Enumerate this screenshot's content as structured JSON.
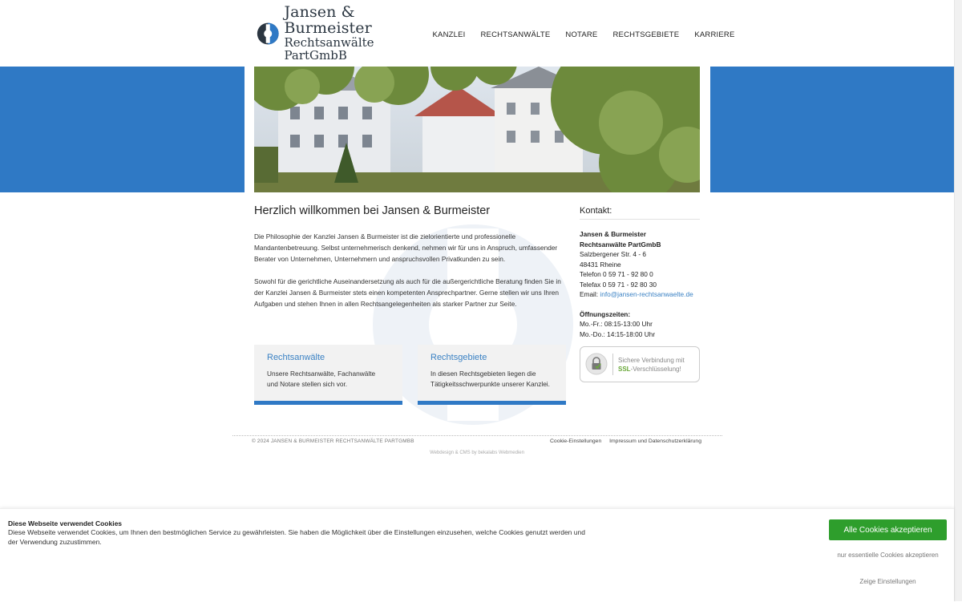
{
  "brand": {
    "name_line1": "Jansen & Burmeister",
    "name_line2": "Rechtsanwälte PartGmbB",
    "accent": "#2f79c5",
    "link_color": "#3b82c4"
  },
  "nav": {
    "items": [
      {
        "label": "KANZLEI"
      },
      {
        "label": "RECHTSANWÄLTE"
      },
      {
        "label": "NOTARE"
      },
      {
        "label": "RECHTSGEBIETE"
      },
      {
        "label": "KARRIERE"
      }
    ]
  },
  "main": {
    "title": "Herzlich willkommen bei Jansen & Burmeister",
    "paragraph1": "Die Philosophie der Kanzlei Jansen & Burmeister ist die zielorientierte und professionelle Mandantenbetreuung. Selbst unternehmerisch denkend, nehmen wir für uns in Anspruch, umfassender Berater von Unternehmen, Unternehmern und anspruchsvollen Privatkunden zu sein.",
    "paragraph2": "Sowohl für die gerichtliche Auseinandersetzung als auch für die außergerichtliche Beratung finden Sie in der Kanzlei Jansen & Burmeister stets einen kompetenten Ansprechpartner. Gerne stellen wir uns Ihren Aufgaben und stehen Ihnen in allen Rechtsangelegenheiten als starker Partner zur Seite."
  },
  "cards": [
    {
      "title": "Rechtsanwälte",
      "text": "Unsere Rechtsanwälte, Fachanwälte und Notare stellen sich vor."
    },
    {
      "title": "Rechtsgebiete",
      "text": "In diesen Rechtsgebieten liegen die Tätigkeitsschwerpunkte unserer Kanzlei."
    }
  ],
  "contact": {
    "heading": "Kontakt:",
    "firm_line1": "Jansen & Burmeister",
    "firm_line2": "Rechtsanwälte PartGmbB",
    "street": "Salzbergener Str. 4 - 6",
    "city": "48431 Rheine",
    "phone": "Telefon 0 59 71 - 92 80 0",
    "fax": "Telefax 0 59 71 - 92 80 30",
    "email_label": "Email: ",
    "email": "info@jansen-rechtsanwaelte.de",
    "hours_heading": "Öffnungszeiten:",
    "hours_line1": "Mo.-Fr.: 08:15-13:00 Uhr",
    "hours_line2": "Mo.-Do.: 14:15-18:00 Uhr"
  },
  "ssl_badge": {
    "line1": "Sichere Verbindung mit",
    "ssl": "SSL",
    "line2_rest": "-Verschlüsselung!"
  },
  "footer": {
    "copyright": "© 2024 JANSEN & BURMEISTER RECHTSANWÄLTE PARTGMBB",
    "link_cookies": "Cookie-Einstellungen",
    "link_imprint": "Impressum und Datenschutzerklärung",
    "credit": "Webdesign & CMS by bekalabs Webmedien"
  },
  "cookie_banner": {
    "title": "Diese Webseite verwendet Cookies",
    "text": "Diese Webseite verwendet Cookies, um Ihnen den bestmöglichen Service zu gewährleisten. Sie haben die Möglichkeit über die Einstellungen einzusehen, welche Cookies genutzt werden und der Verwendung zuzustimmen.",
    "accept_all": "Alle Cookies akzeptieren",
    "essential_only": "nur essentielle Cookies akzeptieren",
    "show_settings": "Zeige Einstellungen",
    "accept_color": "#2e9e2c"
  }
}
